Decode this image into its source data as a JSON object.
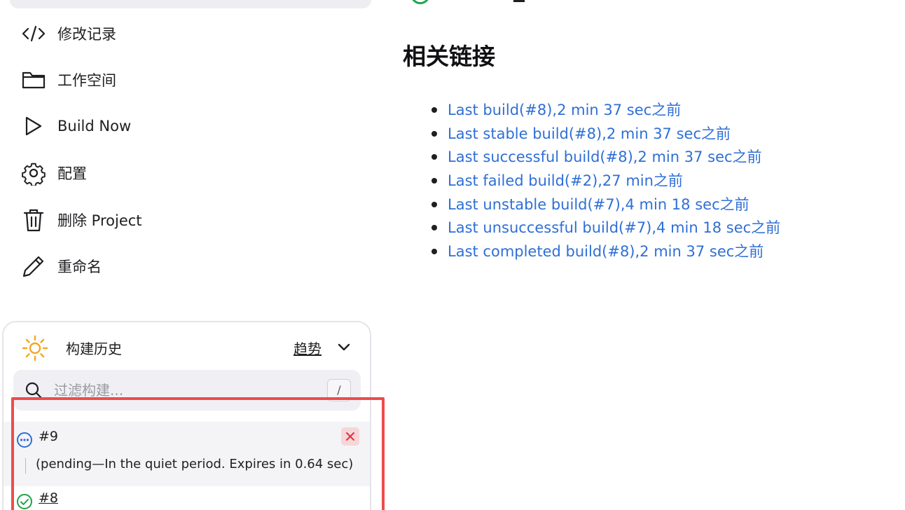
{
  "sidebar": {
    "tasks": [
      {
        "label": "修改记录",
        "icon": "code-icon"
      },
      {
        "label": "工作空间",
        "icon": "folder-icon"
      },
      {
        "label": "Build Now",
        "icon": "play-icon"
      },
      {
        "label": "配置",
        "icon": "gear-icon"
      },
      {
        "label": "删除 Project",
        "icon": "trash-icon"
      },
      {
        "label": "重命名",
        "icon": "pencil-icon"
      }
    ]
  },
  "build_history": {
    "title": "构建历史",
    "trend_label": "趋势",
    "filter": {
      "placeholder": "过滤构建...",
      "shortcut": "/"
    },
    "builds": [
      {
        "number": "#9",
        "status": "pending",
        "status_icon": "pending-icon",
        "description": "(pending—In the quiet period. Expires in 0.64 sec)"
      },
      {
        "number": "#8",
        "status": "success",
        "status_icon": "success-check-icon"
      }
    ]
  },
  "main": {
    "section_title": "相关链接",
    "links": [
      "Last build(#8),2 min 37 sec之前",
      "Last stable build(#8),2 min 37 sec之前",
      "Last successful build(#8),2 min 37 sec之前",
      "Last failed build(#2),27 min之前",
      "Last unstable build(#7),4 min 18 sec之前",
      "Last unsuccessful build(#7),4 min 18 sec之前",
      "Last completed build(#8),2 min 37 sec之前"
    ]
  },
  "colors": {
    "link": "#2f6fd6",
    "success": "#1ea446",
    "pending": "#2f6fd6",
    "highlight": "#ef4b4b",
    "sun": "#f5a623"
  }
}
